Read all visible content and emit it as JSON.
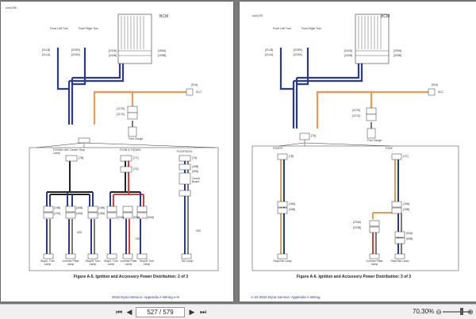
{
  "left_page": {
    "header_id": "a1e1236",
    "bcm_label": "BCM",
    "figure_caption": "Figure A-5. Ignition and Accessory Power Distribution: 2 of 3",
    "footer": "2016 Dyna Service:  Appendix A Wiring   A-9",
    "labels": {
      "front_left": "Front Left Turn",
      "front_right": "Front Right Turn",
      "c21_lb": "[21LB]",
      "c21_la": "[21LA]",
      "c21_rb": "[21RB]",
      "c21_ra": "[21RA]",
      "c242a": "[242A]",
      "c242b": "[242B]",
      "c250a": "[250A]",
      "c250b": "[250B]",
      "c91a": "[91A]",
      "dlc": "DLC",
      "c117b": "[117B]",
      "c117a": "[117A]",
      "fuel_gauge": "Fuel Gauge",
      "fxdwg": "FXDWG WG Center Stop Lamp",
      "fxdb": "FXDB & FXDWG",
      "fld": "FLD/FXDC/L",
      "c7b": "[7B]",
      "c7c": "[7C]",
      "c7d": "[7D]",
      "c7a": "[7A]",
      "c45b": "[45B]",
      "c45a": "[45A]",
      "circuit_board": "Circuit Board",
      "c19b": "[19B]",
      "c19a": "[19A]",
      "c40b": "[40B]",
      "c40a": "[40A]",
      "c18b": "[18B]",
      "c18a": "[18A]",
      "c20a": "[20A]",
      "c20b": "[20B]",
      "c93a": "[93A]",
      "c93b": "[93B]",
      "c94a": "[94A]",
      "c94b": "[94B]",
      "hdi": "HDI",
      "stop_left": "Stop/L Turn Lamp",
      "license": "License Plate Lamp",
      "stop_right": "Stop/R Turn Lamp",
      "stop_left2": "Stop/L Turn Lamp",
      "license2": "License Plate Lamp",
      "stop_right2": "Stop/R Turn Lamp",
      "tail": "Tail Lamp"
    }
  },
  "right_page": {
    "header_id": "a1e1237",
    "bcm_label": "BCM",
    "figure_caption": "Figure A-6. Ignition and Accessory Power Distribution: 3 of 3",
    "footer": "A-10  2016 Dyna Service:  Appendix A Wiring",
    "labels": {
      "front_left": "Front Left Turn",
      "front_right": "Front Right Turn",
      "c21_lb": "[21LB]",
      "c21_la": "[21LA]",
      "c21_rb": "[21RB]",
      "c21_ra": "[21RA]",
      "c242a": "[242A]",
      "c242b": "[242B]",
      "c250a": "[250A]",
      "c250b": "[250B]",
      "c91a": "[91A]",
      "dlc": "DLC",
      "c117b": "[117B]",
      "c117a": "[117A]",
      "fuel_gauge": "Fuel Gauge",
      "c7a": "[7A]",
      "fxdf": "FXDF/P",
      "c7b": "[7B]",
      "fxdf2": "FXDF",
      "c7c": "[7C]",
      "c18a": "[18A]",
      "c18b": "[18B]",
      "c233a": "[233A]",
      "c233b": "[233B]",
      "c93a": "[93A]",
      "c93b": "[93B]",
      "stop_tail": "Stop/Tail Lamp",
      "license": "License Plate Lamp",
      "stop_tail2": "Stop/Tail Lamp"
    }
  },
  "toolbar": {
    "first": "⏮",
    "prev": "◀",
    "page_value": "527 / 579",
    "next": "▶",
    "last": "⏭",
    "zoom_out": "⊖",
    "zoom": "70,30%",
    "zoom_in": "⊕"
  },
  "colors": {
    "wire_blue": "#2b3a8f",
    "wire_orange": "#e89a56",
    "wire_red": "#d44040",
    "wire_black": "#222222"
  }
}
